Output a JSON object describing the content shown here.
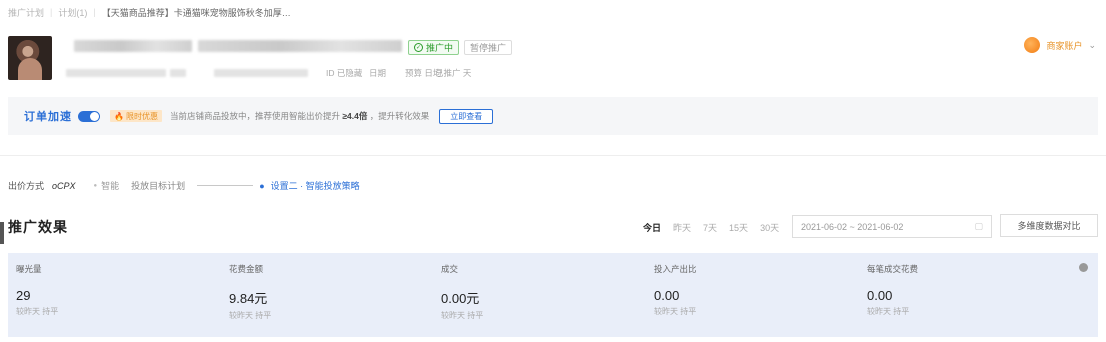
{
  "breadcrumb": {
    "items": [
      "推广计划",
      "计划(1)",
      "【天猫商品推荐】卡通猫咪宠物服饰秋冬加厚…"
    ]
  },
  "header": {
    "tag_green": "推广中",
    "tag_gray": "暂停推广",
    "meta": [
      "ID 已隐藏",
      "日期",
      "预算 日均",
      "已推广 天"
    ]
  },
  "account": {
    "name": "商家账户"
  },
  "notice": {
    "label": "订单加速",
    "promo": "限时优惠",
    "text_prefix": "当前店铺商品投放中，推荐使用智能出价提升 ",
    "text_bold": "≥4.4倍",
    "text_suffix": " ，提升转化效果",
    "button": "立即查看"
  },
  "steps": {
    "mode_label": "出价方式",
    "mode_value": "oCPX",
    "step1": "智能",
    "step2": "投放目标计划",
    "step3_pin": "●",
    "step3": "设置二 · 智能投放策略"
  },
  "section": {
    "title": "推广效果"
  },
  "time_tabs": [
    "今日",
    "昨天",
    "7天",
    "15天",
    "30天"
  ],
  "date_range": "2021-06-02 ~ 2021-06-02",
  "compare_button": "多维度数据对比",
  "metrics": [
    {
      "label": "曝光量",
      "value": "29",
      "compare": "较昨天 持平"
    },
    {
      "label": "花费金额",
      "value": "9.84元",
      "compare": "较昨天 持平"
    },
    {
      "label": "成交",
      "value": "0.00元",
      "compare": "较昨天 持平"
    },
    {
      "label": "投入产出比",
      "value": "0.00",
      "compare": "较昨天 持平"
    },
    {
      "label": "每笔成交花费",
      "value": "0.00",
      "compare": "较昨天 持平"
    }
  ]
}
